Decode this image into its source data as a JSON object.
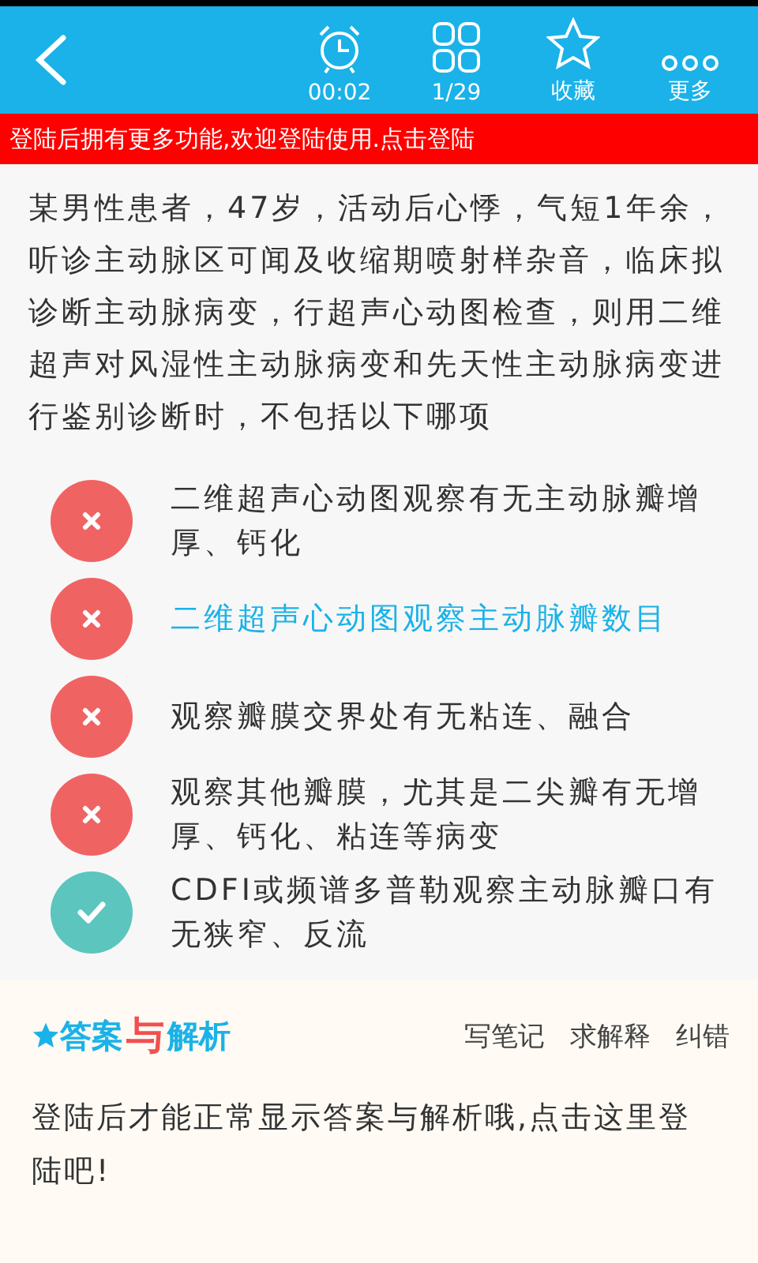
{
  "toolbar": {
    "items": [
      {
        "kind": "timer",
        "label": "00:02"
      },
      {
        "kind": "grid",
        "label": "1/29"
      },
      {
        "kind": "star",
        "label": "收藏"
      },
      {
        "kind": "more",
        "label": "更多"
      }
    ]
  },
  "login_banner": "登陆后拥有更多功能,欢迎登陆使用.点击登陆",
  "question": "某男性患者，47岁，活动后心悸，气短1年余，听诊主动脉区可闻及收缩期喷射样杂音，临床拟诊断主动脉病变，行超声心动图检查，则用二维超声对风湿性主动脉病变和先天性主动脉病变进行鉴别诊断时，不包括以下哪项",
  "options": [
    {
      "text": "二维超声心动图观察有无主动脉瓣增厚、钙化",
      "kind": "wrong",
      "selected": false
    },
    {
      "text": "二维超声心动图观察主动脉瓣数目",
      "kind": "wrong",
      "selected": true
    },
    {
      "text": "观察瓣膜交界处有无粘连、融合",
      "kind": "wrong",
      "selected": false
    },
    {
      "text": "观察其他瓣膜，尤其是二尖瓣有无增厚、钙化、粘连等病变",
      "kind": "wrong",
      "selected": false
    },
    {
      "text": "CDFI或频谱多普勒观察主动脉瓣口有无狭窄、反流",
      "kind": "correct",
      "selected": false
    }
  ],
  "answer": {
    "title_parts": [
      "答案",
      "与",
      "解析"
    ],
    "actions": [
      "写笔记",
      "求解释",
      "纠错"
    ],
    "message": "登陆后才能正常显示答案与解析哦,点击这里登陆吧!"
  }
}
